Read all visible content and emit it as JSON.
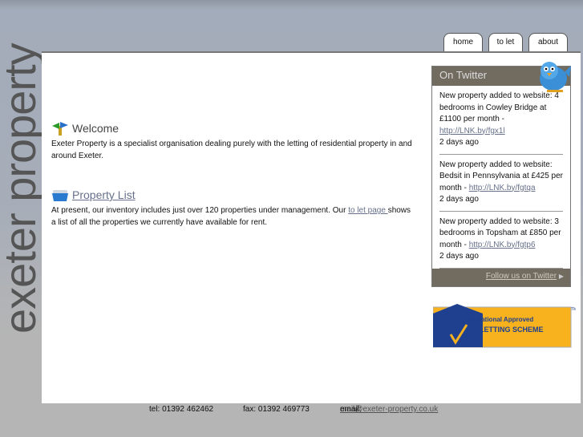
{
  "logo": "exeter property",
  "nav": {
    "tabs": [
      {
        "label": "home"
      },
      {
        "label": "to let"
      },
      {
        "label": "about"
      }
    ]
  },
  "welcome": {
    "title": "Welcome",
    "text": "Exeter Property is a specialist organisation dealing purely with the letting of residential property in and around Exeter.",
    "icon": "signpost-icon"
  },
  "property_list": {
    "title": "Property List",
    "text_before": "At present, our inventory includes just over 120 properties under management. Our ",
    "link": "to let page ",
    "text_after": "shows a list of all the properties we currently have available for rent.",
    "icon": "box-icon"
  },
  "twitter": {
    "title": "On Twitter",
    "tweets": [
      {
        "text": "New property added to website: 4 bedrooms in Cowley Bridge at £1100 per month - ",
        "link": "http://LNK.by/fgx1l",
        "time": "2 days ago"
      },
      {
        "text": "New property added to website: Bedsit in Pennsylvania at £425 per month - ",
        "link": "http://LNK.by/fgtqa",
        "time": "2 days ago"
      },
      {
        "text": "New property added to website: 3 bedrooms in Topsham at £850 per month - ",
        "link": "http://LNK.by/fgtp6",
        "time": "2 days ago"
      }
    ],
    "follow": "Follow us on Twitter"
  },
  "badge": {
    "line1": "The National Approved",
    "line2": "LETTING SCHEME",
    "tm": "TM",
    "colors": {
      "blue": "#1f3f8f",
      "yellow": "#f7b21e"
    }
  },
  "footer": {
    "tel": "tel: 01392 462462",
    "fax": "fax: 01392 469773",
    "email_label": "email: ",
    "email": "mail@exeter-property.co.uk"
  }
}
